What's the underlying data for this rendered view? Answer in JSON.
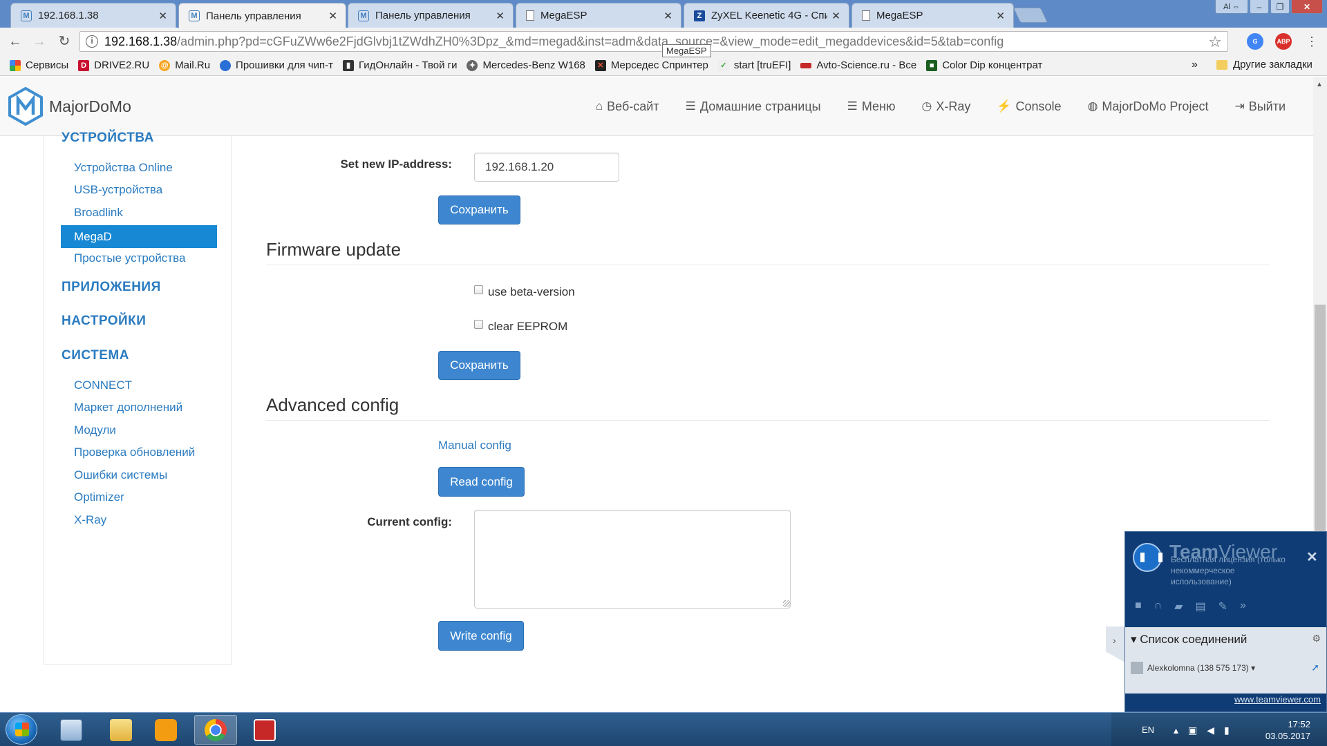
{
  "browser": {
    "tabs": [
      {
        "title": "192.168.1.38",
        "icon": "majordomo-favicon"
      },
      {
        "title": "Панель управления",
        "icon": "majordomo-favicon"
      },
      {
        "title": "Панель управления",
        "icon": "majordomo-favicon"
      },
      {
        "title": "MegaESP",
        "icon": "page-icon"
      },
      {
        "title": "ZyXEL Keenetic 4G - Спи",
        "icon": "zyxel-favicon"
      },
      {
        "title": "MegaESP",
        "icon": "page-icon"
      }
    ],
    "window_user": "Al",
    "address": {
      "host": "192.168.1.38",
      "path": "/admin.php?pd=cGFuZWw6e2FjdGlvbj1tZWdhZH0%3Dpz_&md=megad&inst=adm&data_source=&view_mode=edit_megaddevices&id=5&tab=config"
    },
    "tooltip": "MegaESP",
    "extensions": [
      {
        "label": "G",
        "color": "#4285f4"
      },
      {
        "label": "ABP",
        "color": "#d9302c"
      }
    ],
    "bookmarks": [
      {
        "label": "Сервисы",
        "icon": "apps-grid-icon"
      },
      {
        "label": "DRIVE2.RU",
        "icon": "drive2-icon"
      },
      {
        "label": "Mail.Ru",
        "icon": "mailru-icon"
      },
      {
        "label": "Прошивки для чип-т",
        "icon": "globe-icon"
      },
      {
        "label": "ГидОнлайн - Твой ги",
        "icon": "chart-icon"
      },
      {
        "label": "Mercedes-Benz W168",
        "icon": "mercedes-icon"
      },
      {
        "label": "Мерседес Спринтер",
        "icon": "x-icon"
      },
      {
        "label": "start [truEFI]",
        "icon": "check-icon"
      },
      {
        "label": "Avto-Science.ru - Все",
        "icon": "car-icon"
      },
      {
        "label": "Color Dip концентрат",
        "icon": "colordip-icon"
      }
    ],
    "bookmarks_more": "»",
    "other_bookmarks": "Другие закладки"
  },
  "site": {
    "brand": "MajorDoMo",
    "menu": [
      {
        "label": "Веб-сайт",
        "icon": "home-icon"
      },
      {
        "label": "Домашние страницы",
        "icon": "list-icon"
      },
      {
        "label": "Меню",
        "icon": "list-icon"
      },
      {
        "label": "X-Ray",
        "icon": "gauge-icon"
      },
      {
        "label": "Console",
        "icon": "bolt-icon"
      },
      {
        "label": "MajorDoMo Project",
        "icon": "globe-icon"
      },
      {
        "label": "Выйти",
        "icon": "logout-icon"
      }
    ]
  },
  "sidebar": {
    "sections": [
      {
        "title": "УСТРОЙСТВА"
      },
      {
        "title": "ПРИЛОЖЕНИЯ"
      },
      {
        "title": "НАСТРОЙКИ"
      },
      {
        "title": "СИСТЕМА"
      }
    ],
    "devices": [
      "Устройства Online",
      "USB-устройства",
      "Broadlink",
      "MegaD",
      "Простые устройства"
    ],
    "active_item": "MegaD",
    "system": [
      "CONNECT",
      "Маркет дополнений",
      "Модули",
      "Проверка обновлений",
      "Ошибки системы",
      "Optimizer",
      "X-Ray"
    ]
  },
  "main": {
    "ip": {
      "label": "Set new IP-address:",
      "value": "192.168.1.20",
      "save": "Сохранить"
    },
    "firmware": {
      "title": "Firmware update",
      "beta_label": "use beta-version",
      "beta_checked": false,
      "eeprom_label": "clear EEPROM",
      "eeprom_checked": false,
      "save": "Сохранить"
    },
    "advanced": {
      "title": "Advanced config",
      "manual_link": "Manual config",
      "read_button": "Read config",
      "current_label": "Current config:",
      "current_value": "",
      "write_button": "Write config"
    }
  },
  "teamviewer": {
    "title_bold": "Team",
    "title_rest": "Viewer",
    "license": "Бесплатная лицензия (только некоммерческое использование)",
    "list_title": "Список соединений",
    "user": "Alexkolomna (138 575 173)",
    "link": "www.teamviewer.com"
  },
  "taskbar": {
    "apps": [
      "keyboard-app",
      "explorer-app",
      "media-player-app",
      "chrome-app",
      "ccleaner-app"
    ],
    "active_app": "chrome-app",
    "lang": "EN",
    "time": "17:52",
    "date": "03.05.2017"
  }
}
